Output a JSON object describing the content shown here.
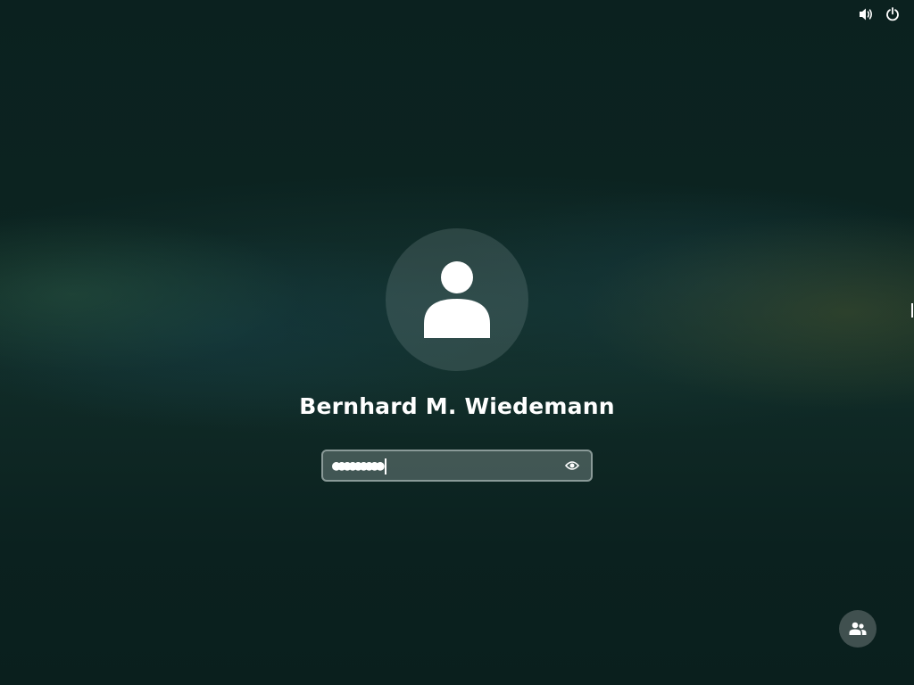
{
  "top_bar": {
    "icons": [
      "volume-icon",
      "power-icon"
    ]
  },
  "user": {
    "avatar_icon": "user-avatar-icon",
    "name": "Bernhard M. Wiedemann"
  },
  "password": {
    "masked_value": "●●●●●●●●●",
    "reveal_icon": "eye-icon"
  },
  "footer": {
    "switch_user_icon": "users-icon"
  },
  "colors": {
    "background": "#0c2220",
    "text": "#ffffff",
    "field_border": "#8a9a98"
  }
}
